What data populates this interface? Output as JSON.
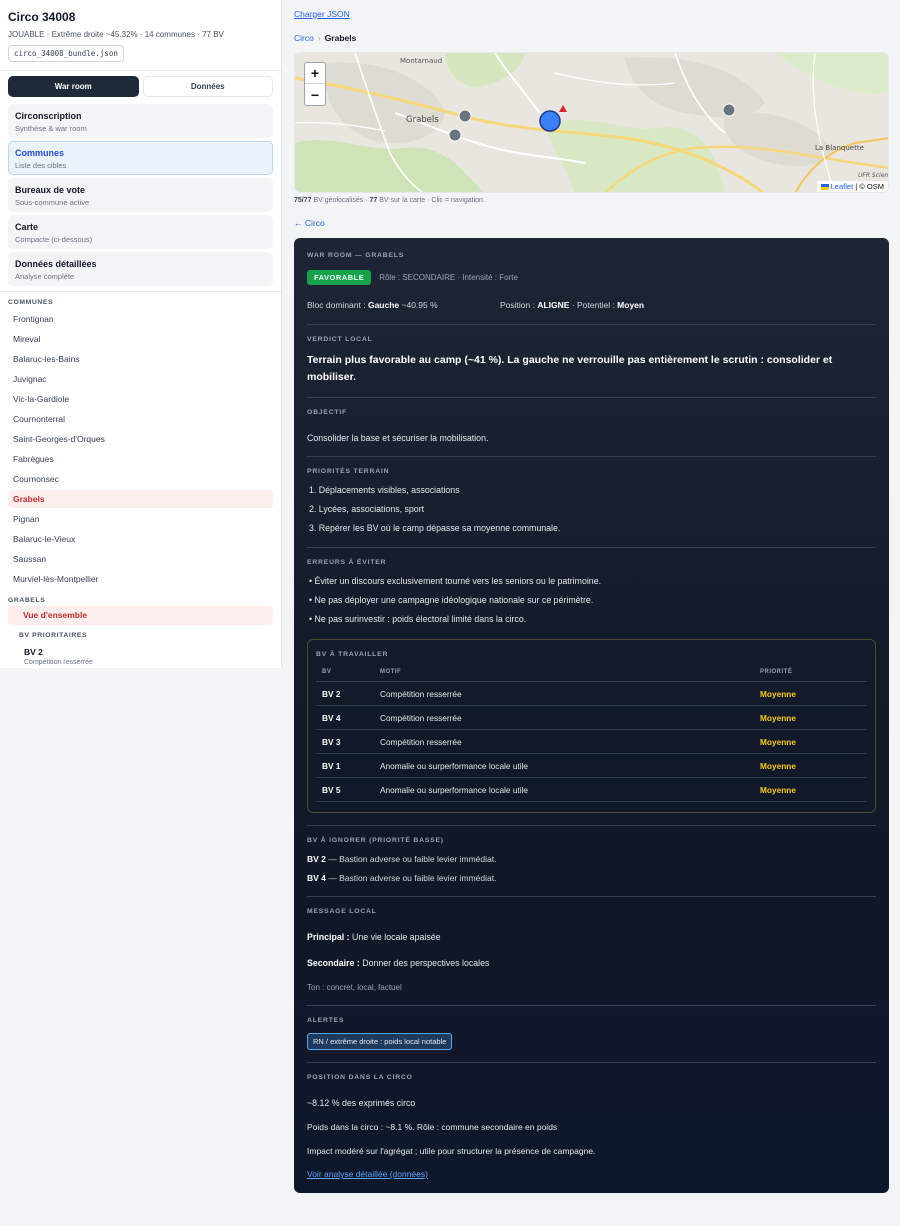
{
  "sidebar": {
    "title": "Circo 34008",
    "meta": "JOUABLE · Extrême droite ~45.32% · 14 communes · 77 BV",
    "file": "circo_34008_bundle.json",
    "tabs": [
      "War room",
      "Données"
    ],
    "nav": [
      {
        "title": "Circonscription",
        "sub": "Synthèse & war room"
      },
      {
        "title": "Communes",
        "sub": "Liste des cibles"
      },
      {
        "title": "Bureaux de vote",
        "sub": "Sous-commune active"
      },
      {
        "title": "Carte",
        "sub": "Compacte (ci-dessous)"
      },
      {
        "title": "Données détaillées",
        "sub": "Analyse complète"
      }
    ],
    "communes_label": "COMMUNES",
    "communes": [
      "Frontignan",
      "Mireval",
      "Balaruc-les-Bains",
      "Juvignac",
      "Vic-la-Gardiole",
      "Cournonterral",
      "Saint-Georges-d'Orques",
      "Fabrègues",
      "Cournonsec",
      "Grabels",
      "Pignan",
      "Balaruc-le-Vieux",
      "Saussan",
      "Murviel-lès-Montpellier"
    ],
    "sub_label": "GRABELS",
    "sub_item": "Vue d'ensemble",
    "bv_label": "BV PRIORITAIRES",
    "bv_first": {
      "title": "BV 2",
      "sub": "Compétition resserrée"
    }
  },
  "main": {
    "load_link": "Charger JSON",
    "crumb_parent": "Circo",
    "crumb_sep": "›",
    "crumb_current": "Grabels",
    "map": {
      "labels": [
        "Montarnaud",
        "Grabels",
        "La Blanquette",
        "UFR Scien"
      ],
      "zoom_in": "+",
      "zoom_out": "−",
      "attrib_link": "Leaflet",
      "attrib_rest": "| © OSM",
      "caption_a": "75/77",
      "caption_b": " BV géolocalisés · ",
      "caption_c": "77",
      "caption_d": " BV sur la carte · Clic = navigation."
    },
    "back_link": "← Circo"
  },
  "warroom": {
    "kicker": "WAR ROOM — GRABELS",
    "badge": "FAVORABLE",
    "badge_meta": "Rôle : SECONDAIRE · Intensité : Forte",
    "bloc_label": "Bloc dominant : ",
    "bloc_value": "Gauche",
    "bloc_pct": " ~40.95 %",
    "pos_label": "Position : ",
    "pos_value": "ALIGNE",
    "pot_label": " · Potentiel : ",
    "pot_value": "Moyen",
    "verdict_label": "VERDICT LOCAL",
    "verdict": "Terrain plus favorable au camp (~41 %). La gauche ne verrouille pas entièrement le scrutin : consolider et mobiliser.",
    "objectif_label": "OBJECTIF",
    "objectif": "Consolider la base et sécuriser la mobilisation.",
    "priorites_label": "PRIORITÉS TERRAIN",
    "priorites": [
      "1. Déplacements visibles, associations",
      "2. Lycées, associations, sport",
      "3. Repérer les BV où le camp dépasse sa moyenne communale."
    ],
    "erreurs_label": "ERREURS À ÉVITER",
    "erreurs": [
      "• Éviter un discours exclusivement tourné vers les seniors ou le patrimoine.",
      "• Ne pas déployer une campagne idéologique nationale sur ce périmètre.",
      "• Ne pas surinvestir : poids électoral limité dans la circo."
    ],
    "bv_box_label": "BV À TRAVAILLER",
    "bv_cols": [
      "BV",
      "MOTIF",
      "PRIORITÉ"
    ],
    "bv_rows": [
      {
        "bv": "BV 2",
        "motif": "Compétition resserrée",
        "prio": "Moyenne"
      },
      {
        "bv": "BV 4",
        "motif": "Compétition resserrée",
        "prio": "Moyenne"
      },
      {
        "bv": "BV 3",
        "motif": "Compétition resserrée",
        "prio": "Moyenne"
      },
      {
        "bv": "BV 1",
        "motif": "Anomalie ou surperformance locale utile",
        "prio": "Moyenne"
      },
      {
        "bv": "BV 5",
        "motif": "Anomalie ou surperformance locale utile",
        "prio": "Moyenne"
      }
    ],
    "ignore_label": "BV À IGNORER (PRIORITÉ BASSE)",
    "ignore": [
      {
        "bv": "BV 2",
        "text": " — Bastion adverse ou faible levier immédiat."
      },
      {
        "bv": "BV 4",
        "text": " — Bastion adverse ou faible levier immédiat."
      }
    ],
    "message_label": "MESSAGE LOCAL",
    "msg_principal_label": "Principal : ",
    "msg_principal": "Une vie locale apaisée",
    "msg_secondaire_label": "Secondaire : ",
    "msg_secondaire": "Donner des perspectives locales",
    "ton": "Ton : concret, local, factuel",
    "alertes_label": "ALERTES",
    "alerte": "RN / extrême droite : poids local notable",
    "position_label": "POSITION DANS LA CIRCO",
    "pos_exprimes": "~8.12 % des exprimés circo",
    "pos_poids": "Poids dans la circo : ~8.1 %. Rôle : commune secondaire en poids",
    "pos_impact": "Impact modéré sur l'agrégat ; utile pour structurer la présence de campagne.",
    "detail_link": "Voir analyse détaillée (données)"
  },
  "colors": {
    "accent": "#2563eb",
    "favorable": "#16a34a",
    "priority": "#facc15",
    "active_commune": "#c22b2b"
  }
}
